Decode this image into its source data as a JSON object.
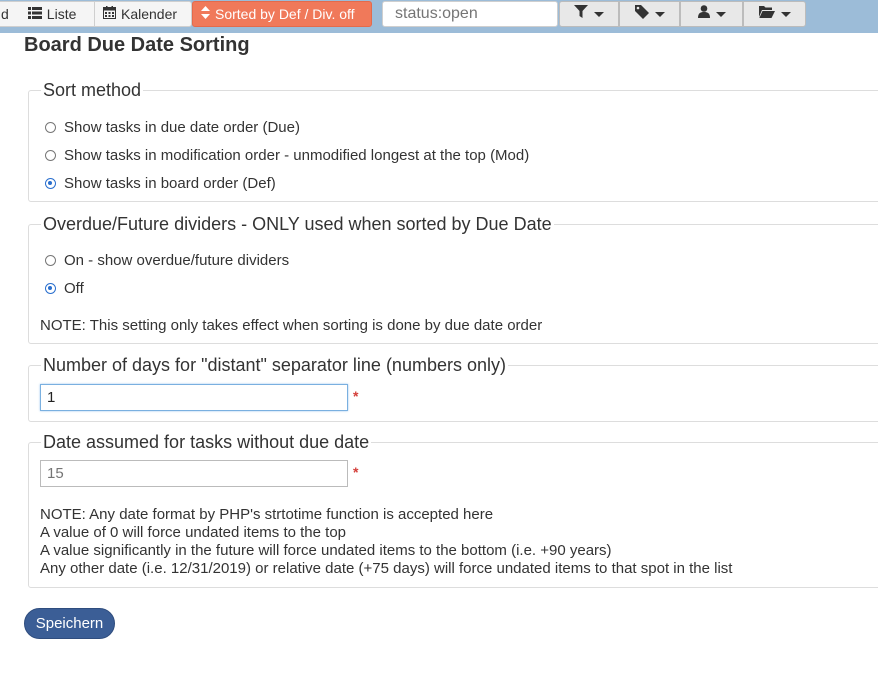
{
  "toolbar": {
    "first_fragment": "d",
    "liste_label": "Liste",
    "kalender_label": "Kalender",
    "sort_label": "Sorted by Def / Div. off",
    "search_placeholder": "status:open",
    "filter_icons": [
      "filter-icon",
      "tag-icon",
      "user-icon",
      "folder-open-icon"
    ]
  },
  "page": {
    "title": "Board Due Date Sorting"
  },
  "sort_method": {
    "legend": "Sort method",
    "options": [
      {
        "label": "Show tasks in due date order (Due)",
        "checked": false
      },
      {
        "label": "Show tasks in modification order - unmodified longest at the top (Mod)",
        "checked": false
      },
      {
        "label": "Show tasks in board order (Def)",
        "checked": true
      }
    ]
  },
  "dividers": {
    "legend": "Overdue/Future dividers - ONLY used when sorted by Due Date",
    "options": [
      {
        "label": "On - show overdue/future dividers",
        "checked": false
      },
      {
        "label": "Off",
        "checked": true
      }
    ],
    "note": "NOTE: This setting only takes effect when sorting is done by due date order"
  },
  "distant": {
    "legend": "Number of days for \"distant\" separator line (numbers only)",
    "value": "1",
    "required_mark": "*"
  },
  "undated": {
    "legend": "Date assumed for tasks without due date",
    "placeholder": "15",
    "required_mark": "*",
    "notes": [
      "NOTE: Any date format by PHP's strtotime function is accepted here",
      "A value of 0 will force undated items to the top",
      "A value significantly in the future will force undated items to the bottom (i.e. +90 years)",
      "Any other date (i.e. 12/31/2019) or relative date (+75 days) will force undated items to that spot in the list"
    ]
  },
  "save_label": "Speichern",
  "colors": {
    "toolbar_bg": "#9cbcd8",
    "sort_button": "#f0795a",
    "save_button": "#3b5e96",
    "radio_checked": "#2a6fce",
    "required": "#d43f3a"
  }
}
